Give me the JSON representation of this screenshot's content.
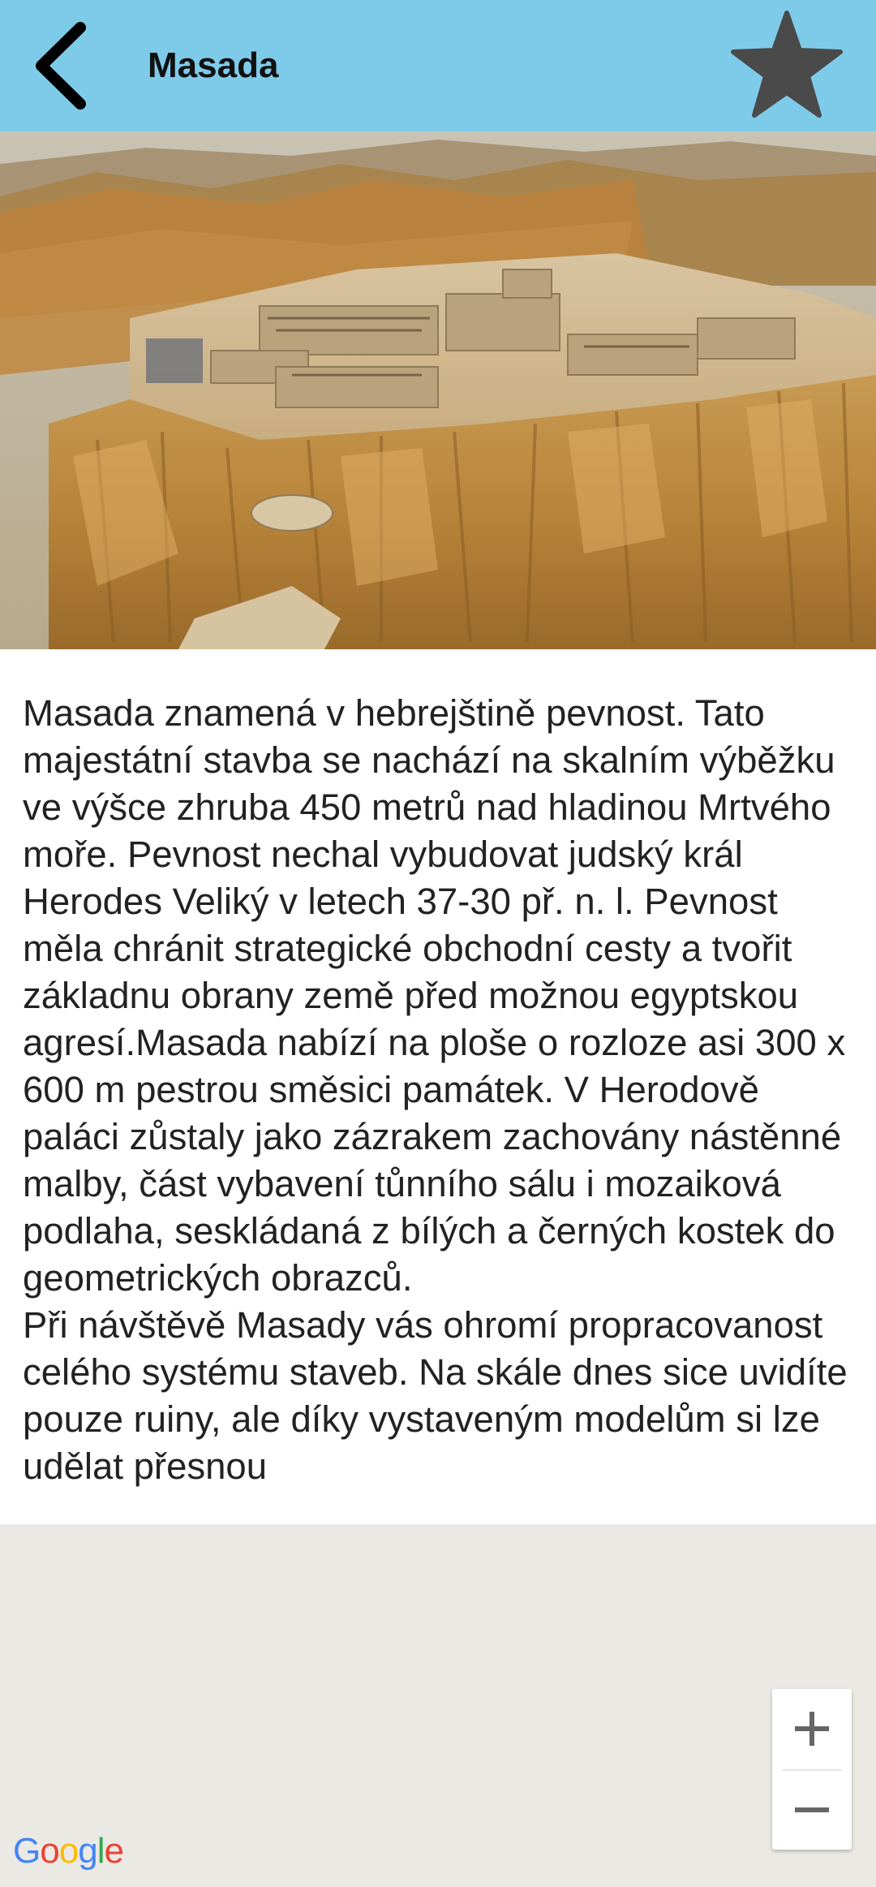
{
  "header": {
    "title": "Masada",
    "back_icon": "chevron-left-icon",
    "favorite_icon": "star-icon",
    "background_color": "#7ecbe9"
  },
  "hero_image": {
    "subject": "aerial-photo-masada-fortress"
  },
  "description": {
    "paragraph_1": "Masada znamená v hebrejštině pevnost. Tato majestátní stavba se nachází na skalním výběžku ve výšce zhruba 450 metrů nad hladinou Mrtvého moře. Pevnost nechal vybudovat judský král Herodes Veliký v letech 37-30 př. n. l. Pevnost měla chránit strategické obchodní cesty a tvořit základnu obrany země před možnou egyptskou agresí.Masada nabízí na ploše o rozloze asi 300 x 600 m pestrou směsici památek. V Herodově paláci zůstaly jako zázrakem zachovány nástěnné malby, část vybavení tůnního sálu i mozaiková podlaha, seskládaná z bílých a černých kostek do geometrických obrazců.",
    "paragraph_2": "Při návštěvě Masady vás ohromí propracovanost celého systému staveb. Na skále dnes sice uvidíte pouze ruiny, ale díky vystaveným modelům si lze udělat přesnou"
  },
  "map": {
    "zoom_in_label": "+",
    "zoom_out_label": "−",
    "logo": {
      "letters": [
        "G",
        "o",
        "o",
        "g",
        "l",
        "e"
      ],
      "colors": [
        "#4285f4",
        "#ea4335",
        "#fbbc05",
        "#4285f4",
        "#34a853",
        "#ea4335"
      ]
    },
    "background_color": "#ebe9e4"
  }
}
